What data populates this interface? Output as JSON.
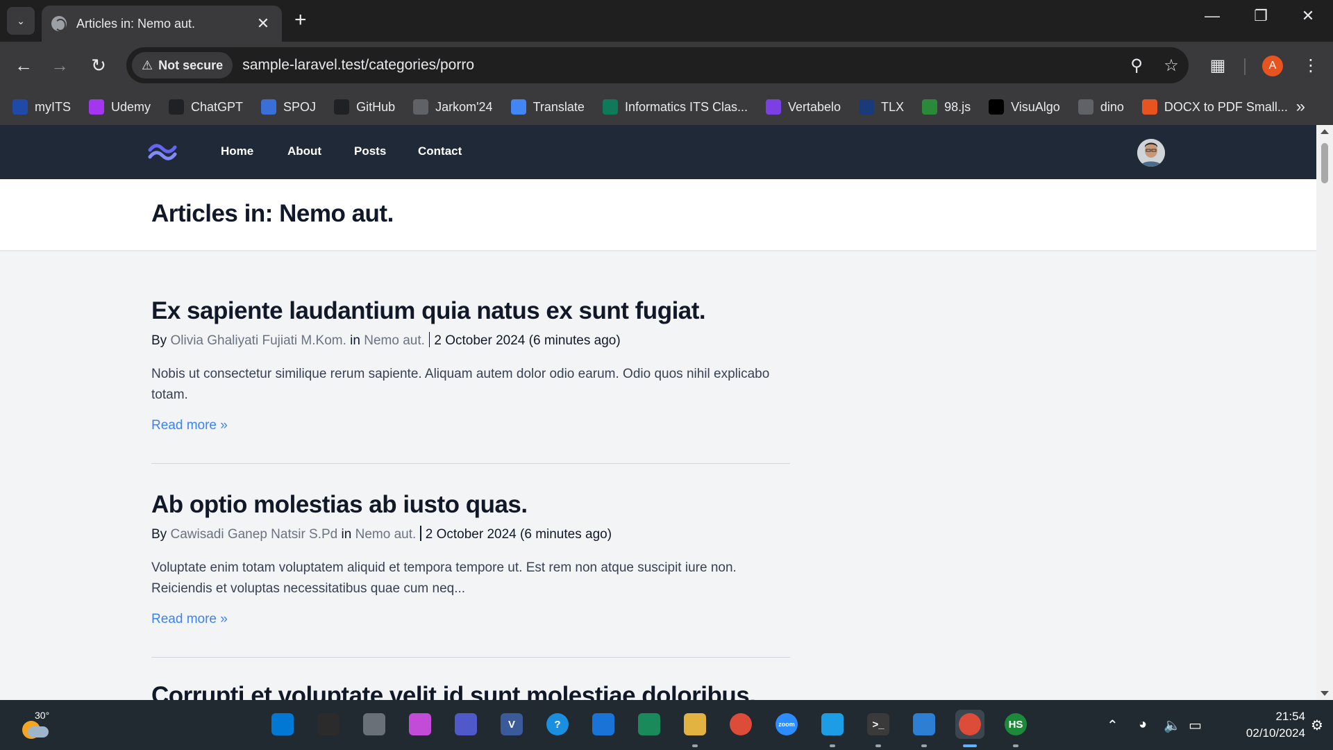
{
  "browser": {
    "tab_title": "Articles in: Nemo aut.",
    "security_label": "Not secure",
    "url": "sample-laravel.test/categories/porro",
    "profile_initial": "A",
    "bookmarks": [
      {
        "label": "myITS",
        "icon": "its-icon",
        "color": "#1f4aa8"
      },
      {
        "label": "Udemy",
        "icon": "udemy-icon",
        "color": "#a435f0"
      },
      {
        "label": "ChatGPT",
        "icon": "chatgpt-icon",
        "color": "#202124"
      },
      {
        "label": "SPOJ",
        "icon": "spoj-icon",
        "color": "#3b6fd8"
      },
      {
        "label": "GitHub",
        "icon": "github-icon",
        "color": "#202124"
      },
      {
        "label": "Jarkom'24",
        "icon": "globe-icon",
        "color": "#5f6368"
      },
      {
        "label": "Translate",
        "icon": "translate-icon",
        "color": "#4285f4"
      },
      {
        "label": "Informatics ITS Clas...",
        "icon": "tc-icon",
        "color": "#0f7a5a"
      },
      {
        "label": "Vertabelo",
        "icon": "vertabelo-icon",
        "color": "#7b3fe4"
      },
      {
        "label": "TLX",
        "icon": "tlx-icon",
        "color": "#1a3a7a"
      },
      {
        "label": "98.js",
        "icon": "windows98-icon",
        "color": "#2a8a3a"
      },
      {
        "label": "VisuAlgo",
        "icon": "visualgo-icon",
        "color": "#000000"
      },
      {
        "label": "dino",
        "icon": "globe-icon",
        "color": "#5f6368"
      },
      {
        "label": "DOCX to PDF Small...",
        "icon": "smallpdf-icon",
        "color": "#e8541f"
      }
    ]
  },
  "site": {
    "nav": [
      "Home",
      "About",
      "Posts",
      "Contact"
    ],
    "page_title": "Articles in: Nemo aut."
  },
  "articles": [
    {
      "title": "Ex sapiente laudantium quia natus ex sunt fugiat.",
      "by_label": "By",
      "author": "Olivia Ghaliyati Fujiati M.Kom.",
      "in_label": "in",
      "category": "Nemo aut.",
      "date": "2 October 2024 (6 minutes ago)",
      "excerpt": "Nobis ut consectetur similique rerum sapiente. Aliquam autem dolor odio earum. Odio quos nihil explicabo totam.",
      "read_more": "Read more »"
    },
    {
      "title": "Ab optio molestias ab iusto quas.",
      "by_label": "By",
      "author": "Cawisadi Ganep Natsir S.Pd",
      "in_label": "in",
      "category": "Nemo aut.",
      "date": "2 October 2024 (6 minutes ago)",
      "excerpt": "Voluptate enim totam voluptatem aliquid et tempora tempore ut. Est rem non atque suscipit iure non. Reiciendis et voluptas necessitatibus quae cum neq...",
      "read_more": "Read more »"
    },
    {
      "title": "Corrupti et voluptate velit id sunt molestiae doloribus."
    }
  ],
  "taskbar": {
    "temperature": "30°",
    "time": "21:54",
    "date": "02/10/2024",
    "apps": [
      {
        "name": "start-icon",
        "label": ""
      },
      {
        "name": "search-icon",
        "label": ""
      },
      {
        "name": "task-view-icon",
        "label": ""
      },
      {
        "name": "copilot-icon",
        "label": ""
      },
      {
        "name": "teams-icon",
        "label": ""
      },
      {
        "name": "visual-paradigm-icon",
        "label": "V"
      },
      {
        "name": "help-icon",
        "label": "?"
      },
      {
        "name": "mail-icon",
        "label": ""
      },
      {
        "name": "edge-icon",
        "label": ""
      },
      {
        "name": "file-explorer-icon",
        "label": ""
      },
      {
        "name": "chrome-icon",
        "label": ""
      },
      {
        "name": "zoom-icon",
        "label": "zoom"
      },
      {
        "name": "app-icon",
        "label": ""
      },
      {
        "name": "terminal-icon",
        "label": ">_"
      },
      {
        "name": "vscode-icon",
        "label": ""
      },
      {
        "name": "chrome-active-icon",
        "label": ""
      },
      {
        "name": "hs-icon",
        "label": "HS"
      }
    ]
  }
}
